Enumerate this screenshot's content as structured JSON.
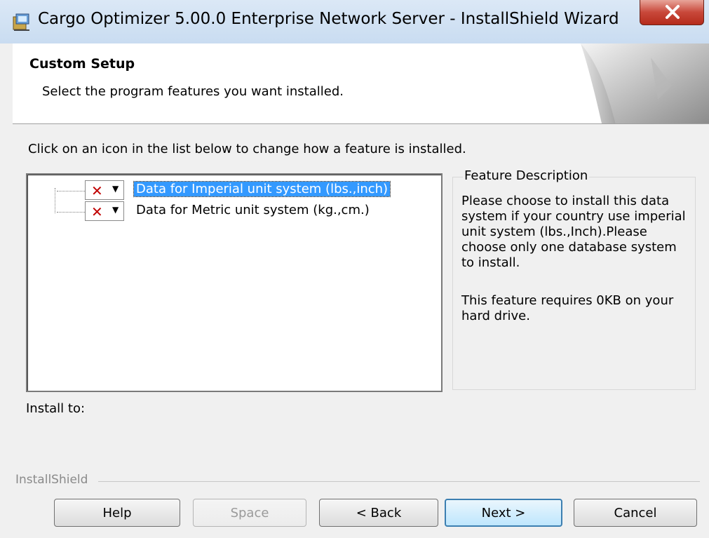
{
  "window": {
    "title": "Cargo Optimizer 5.00.0 Enterprise Network Server - InstallShield Wizard",
    "close_icon": "close-icon"
  },
  "header": {
    "title": "Custom Setup",
    "subtitle": "Select the program features you want installed."
  },
  "body": {
    "instruction": "Click on an icon in the list below to change how a feature is installed.",
    "features": [
      {
        "label": "Data for Imperial unit system (lbs.,inch)",
        "state_icon": "not-installed-x-icon",
        "selected": true
      },
      {
        "label": "Data for Metric unit system (kg.,cm.)",
        "state_icon": "not-installed-x-icon",
        "selected": false
      }
    ],
    "description": {
      "title": "Feature Description",
      "text": "Please choose to install this data system if your country use imperial unit system (lbs.,Inch).Please choose only one database system to install.",
      "requirement": "This feature requires 0KB on your hard drive."
    },
    "install_to_label": "Install to:"
  },
  "footer": {
    "brand": "InstallShield",
    "buttons": {
      "help": "Help",
      "space": "Space",
      "back": "< Back",
      "next": "Next >",
      "cancel": "Cancel"
    }
  }
}
